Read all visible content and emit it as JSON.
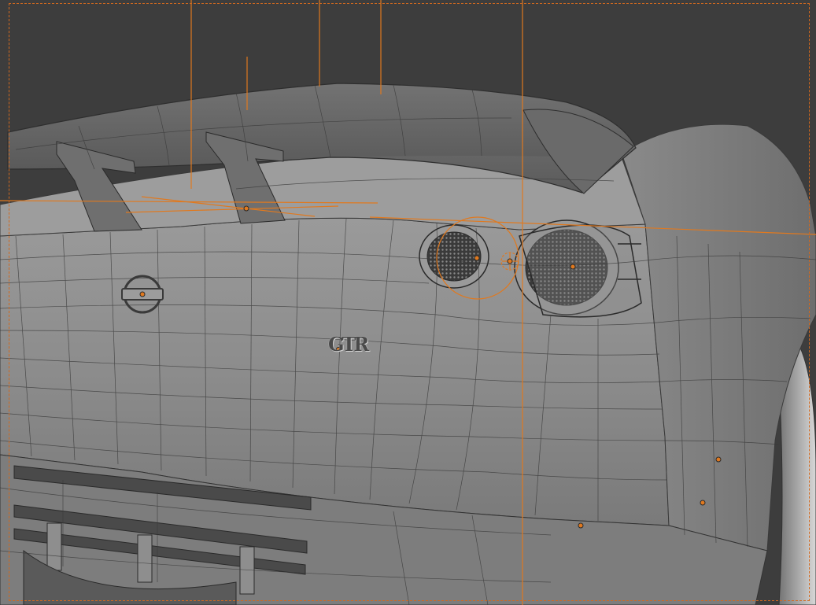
{
  "viewport": {
    "mode": "edit-mode-wireframe-overlay",
    "background": "#3d3d3d",
    "selection_color": "#e0791f",
    "mesh_color": "#8f8f8f",
    "wire_color": "#2a2a2a"
  },
  "model": {
    "emblem_badge": "GTR",
    "logo_icon": "nissan-logo-icon"
  }
}
